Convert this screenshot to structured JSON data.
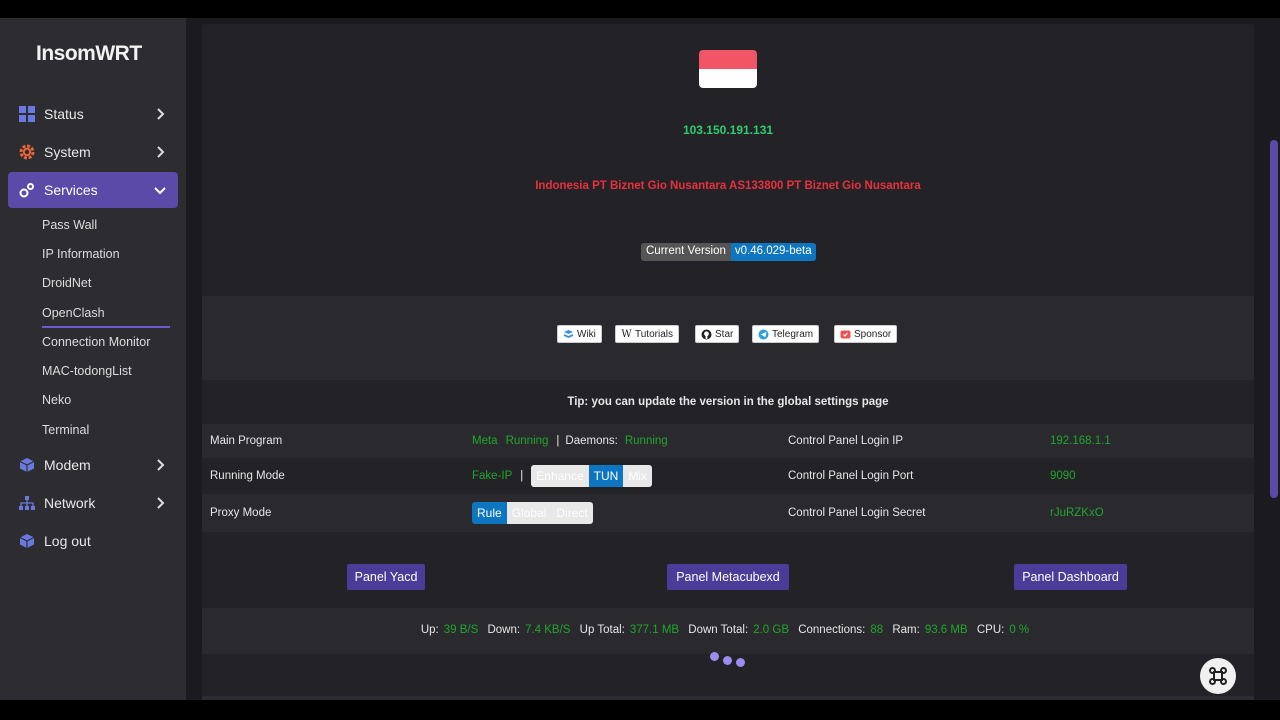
{
  "app": {
    "title": "InsomWRT"
  },
  "sidebar": {
    "items": [
      {
        "label": "Status",
        "icon": "dashboard-icon",
        "active": false
      },
      {
        "label": "System",
        "icon": "gear-icon",
        "active": false
      },
      {
        "label": "Services",
        "icon": "services-icon",
        "active": true
      },
      {
        "label": "Modem",
        "icon": "cube-icon",
        "active": false
      },
      {
        "label": "Network",
        "icon": "network-icon",
        "active": false
      },
      {
        "label": "Log out",
        "icon": "logout-icon",
        "active": false
      }
    ],
    "services_submenu": [
      "Pass Wall",
      "IP Information",
      "DroidNet",
      "OpenClash",
      "Connection Monitor",
      "MAC-todongList",
      "Neko",
      "Terminal"
    ],
    "selected_submenu": "OpenClash"
  },
  "header": {
    "flag": "Indonesia flag",
    "ip": "103.150.191.131",
    "isp": "Indonesia PT Biznet Gio Nusantara AS133800 PT Biznet Gio Nusantara",
    "version_label": "Current Version",
    "version_value": "v0.46.029-beta"
  },
  "links": [
    {
      "label": "Wiki",
      "icon": "book-icon"
    },
    {
      "label": "Tutorials",
      "icon": "wikipedia-icon"
    },
    {
      "label": "Star",
      "icon": "github-icon"
    },
    {
      "label": "Telegram",
      "icon": "telegram-icon"
    },
    {
      "label": "Sponsor",
      "icon": "sponsor-icon"
    }
  ],
  "tip": "Tip: you can update the version in the global settings page",
  "status_table": {
    "main_program": {
      "label": "Main Program",
      "core": "Meta",
      "core_state": "Running",
      "sep": "|",
      "daemons_label": "Daemons:",
      "daemons_state": "Running"
    },
    "running_mode": {
      "label": "Running Mode",
      "value": "Fake-IP",
      "sep": "|",
      "options": [
        "Enhance",
        "TUN",
        "Mix"
      ],
      "selected": "TUN"
    },
    "proxy_mode": {
      "label": "Proxy Mode",
      "options": [
        "Rule",
        "Global",
        "Direct"
      ],
      "selected": "Rule"
    },
    "login_ip": {
      "label": "Control Panel Login IP",
      "value": "192.168.1.1"
    },
    "login_port": {
      "label": "Control Panel Login Port",
      "value": "9090"
    },
    "login_secret": {
      "label": "Control Panel Login Secret",
      "value": "rJuRZKxO"
    }
  },
  "panel_buttons": [
    "Panel Yacd",
    "Panel Metacubexd",
    "Panel Dashboard"
  ],
  "stats": {
    "up_label": "Up:",
    "up": "39 B/S",
    "down_label": "Down:",
    "down": "7.4 KB/S",
    "up_total_label": "Up Total:",
    "up_total": "377.1 MB",
    "down_total_label": "Down Total:",
    "down_total": "2.0 GB",
    "connections_label": "Connections:",
    "connections": "88",
    "ram_label": "Ram:",
    "ram": "93.6 MB",
    "cpu_label": "CPU:",
    "cpu": "0 %"
  },
  "colors": {
    "accent": "#5b4aa8",
    "ok_green": "#1fa62b",
    "ip_green": "#2ecc71",
    "isp_red": "#e8303d",
    "toggle_blue": "#0e76c0"
  }
}
